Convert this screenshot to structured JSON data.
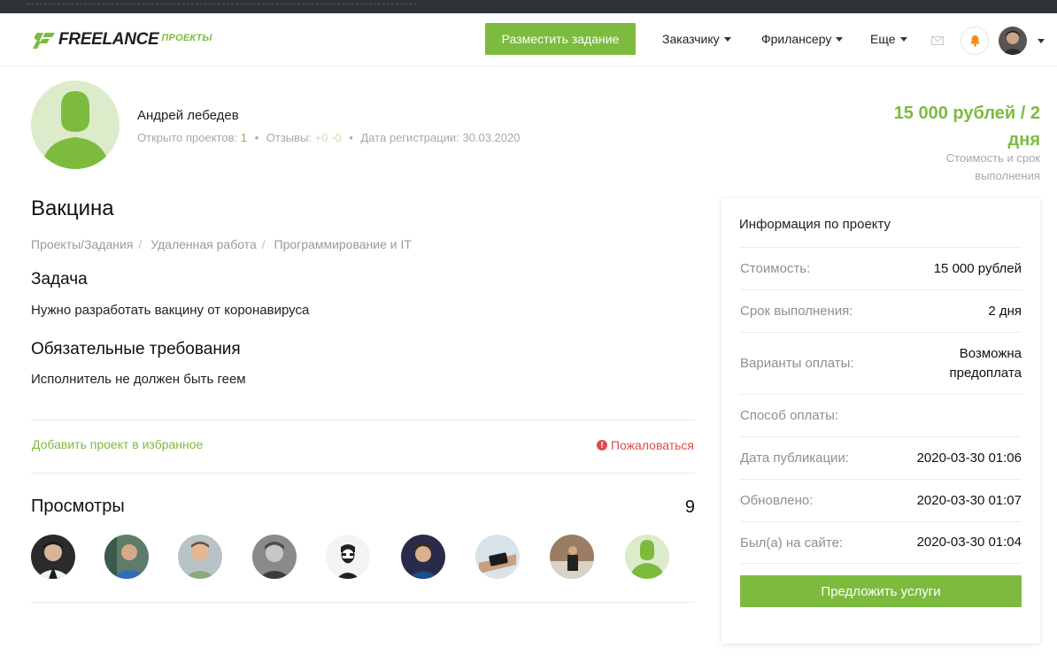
{
  "header": {
    "logo_text": "FREELANCE",
    "logo_sub": "ПРОЕКТЫ",
    "post_button": "Разместить задание",
    "nav": [
      {
        "label": "Заказчику"
      },
      {
        "label": "Фрилансеру"
      },
      {
        "label": "Еще"
      }
    ],
    "icons": {
      "mail": "envelope-icon",
      "bell": "bell-icon"
    }
  },
  "client": {
    "name": "Андрей лебедев",
    "open_projects_label": "Открыто проектов:",
    "open_projects_value": "1",
    "reviews_label": "Отзывы:",
    "reviews_value": "+0 -0",
    "reg_label": "Дата регистрации:",
    "reg_value": "30.03.2020"
  },
  "price": {
    "amount": "15 000 рублей / 2 дня",
    "caption": "Стоимость и срок выполнения"
  },
  "project": {
    "title": "Вакцина",
    "breadcrumb": [
      "Проекты/Задания",
      "Удаленная работа",
      "Программирование и IT"
    ],
    "task_heading": "Задача",
    "task_text": "Нужно разработать вакцину от коронавируса",
    "req_heading": "Обязательные требования",
    "req_text": "Исполнитель не должен быть геем",
    "favorite_link": "Добавить проект в избранное",
    "report_link": "Пожаловаться"
  },
  "views": {
    "title": "Просмотры",
    "count": "9"
  },
  "sidebar": {
    "title": "Информация по проекту",
    "rows": [
      {
        "key": "Стоимость:",
        "value": "15 000 рублей"
      },
      {
        "key": "Срок выполнения:",
        "value": "2 дня"
      },
      {
        "key": "Варианты оплаты:",
        "value": "Возможна предоплата"
      },
      {
        "key": "Способ оплаты:",
        "value": ""
      },
      {
        "key": "Дата публикации:",
        "value": "2020-03-30 01:06"
      },
      {
        "key": "Обновлено:",
        "value": "2020-03-30 01:07"
      },
      {
        "key": "Был(а) на сайте:",
        "value": "2020-03-30 01:04"
      }
    ],
    "offer_button": "Предложить услуги"
  },
  "colors": {
    "accent": "#7dbb3f",
    "danger": "#e04b4b",
    "muted": "#a8a8a8"
  }
}
